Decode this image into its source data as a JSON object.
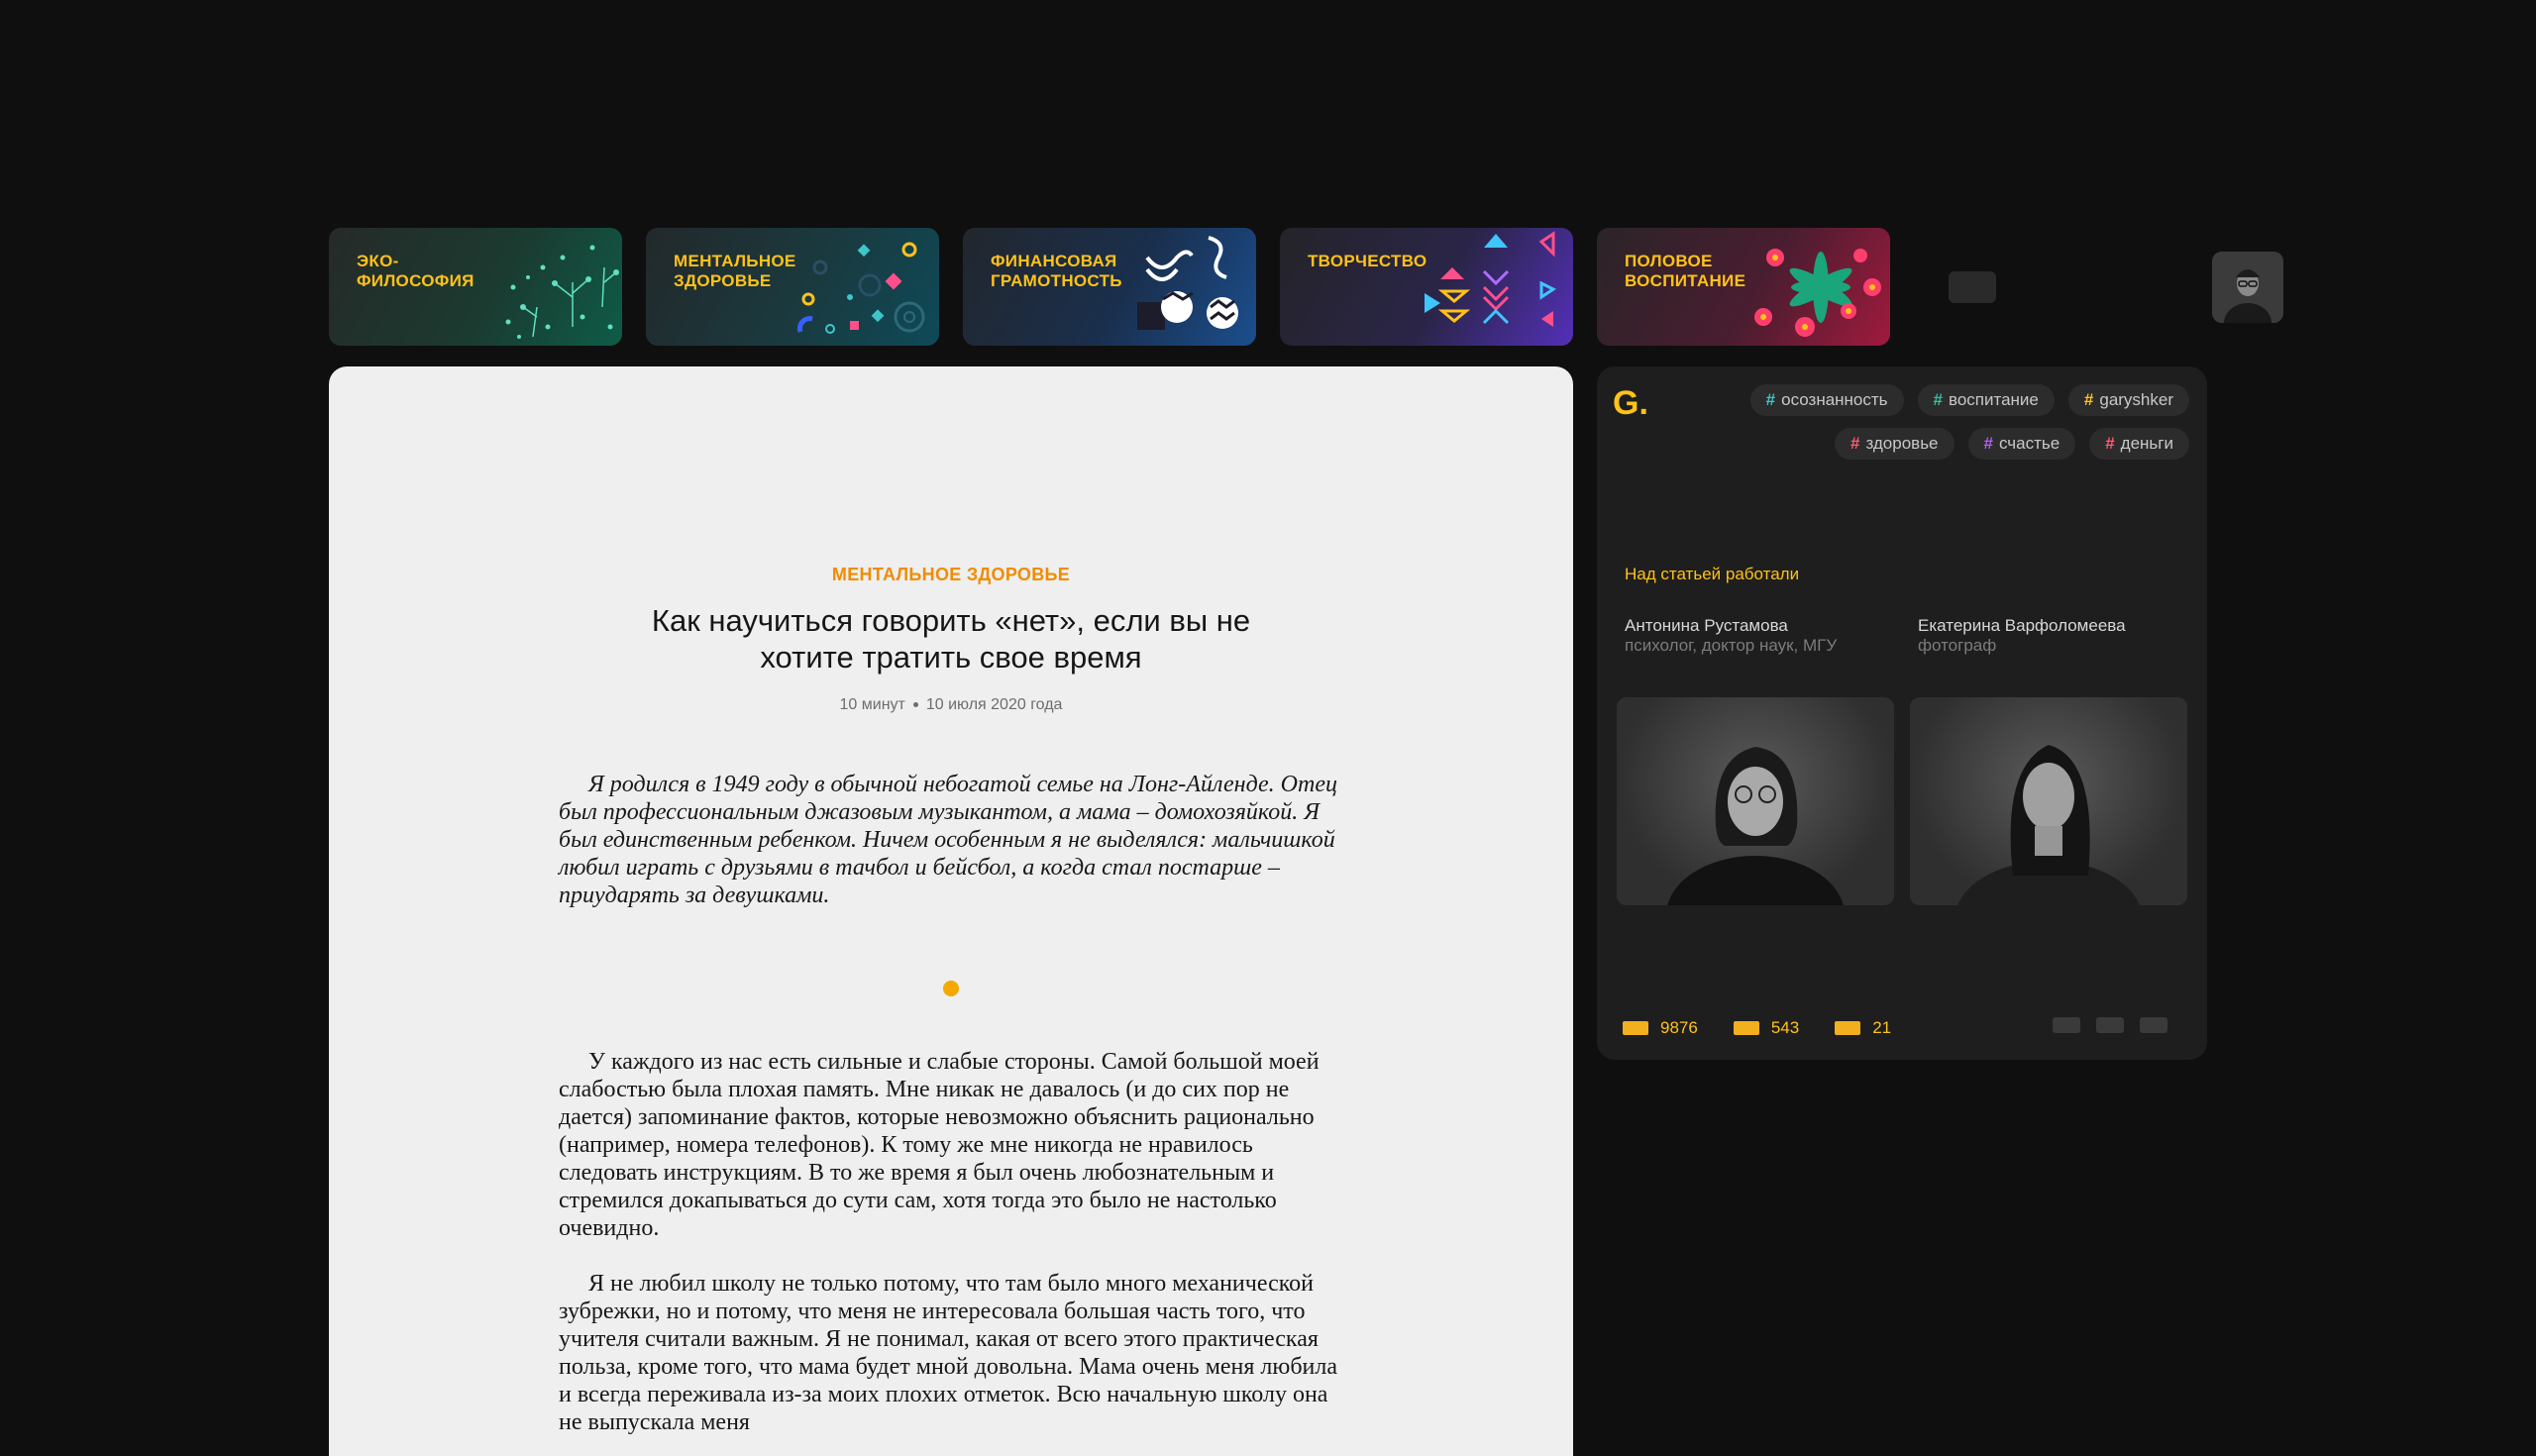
{
  "categories": [
    {
      "label": "Эко-философия",
      "icon": "eco-philosophy-art"
    },
    {
      "label": "Ментальное здоровье",
      "icon": "mental-health-art"
    },
    {
      "label": "Финансовая грамотность",
      "icon": "financial-literacy-art"
    },
    {
      "label": "Творчество",
      "icon": "creativity-art"
    },
    {
      "label": "Половое воспитание",
      "icon": "sex-education-art"
    }
  ],
  "article": {
    "rubric": "Ментальное здоровье",
    "title": "Как научиться говорить «нет», если вы не хотите тратить свое время",
    "read_time": "10 минут",
    "date": "10 июля 2020 года",
    "lead": "Я родился в 1949 году в обычной небогатой семье на Лонг-Айленде. Отец был профессиональным джазовым музыкантом, а мама – домохозяйкой. Я был единственным ребенком. Ничем особенным я не выделялся: мальчишкой любил играть с друзьями в тачбол и бейсбол, а когда стал постарше – приударять за девушками.",
    "paragraphs": [
      "У каждого из нас есть сильные и слабые стороны. Самой большой моей слабостью была плохая память. Мне никак не давалось (и до сих пор не дается) запоминание фактов, которые невозможно объяснить рационально (например, номера телефонов). К тому же мне никогда не нравилось следовать инструкциям. В то же время я был очень любознательным и стремился докапываться до сути сам, хотя тогда это было не настолько очевидно.",
      "Я не любил школу не только потому, что там было много механической зубрежки, но и потому, что меня не интересовала большая часть того, что учителя считали важным. Я не понимал, какая от всего этого практическая польза, кроме того, что мама будет мной довольна. Мама очень меня любила и всегда переживала из-за моих плохих отметок. Всю начальную школу она не выпускала меня"
    ]
  },
  "sidebar": {
    "logo": "G.",
    "tags": [
      {
        "label": "осознанность",
        "color": "#3ec6c9"
      },
      {
        "label": "воспитание",
        "color": "#2ec4a0"
      },
      {
        "label": "garyshker",
        "color": "#ffc21a"
      },
      {
        "label": "здоровье",
        "color": "#ff5a6a"
      },
      {
        "label": "счастье",
        "color": "#b65cf0"
      },
      {
        "label": "деньги",
        "color": "#ff5a6a"
      }
    ],
    "worked_label": "Над статьей работали",
    "authors": [
      {
        "name": "Антонина Рустамова",
        "role": "психолог, доктор наук, МГУ"
      },
      {
        "name": "Екатерина Варфоломеева",
        "role": "фотограф"
      }
    ],
    "stats": [
      {
        "icon": "views-icon",
        "value": "9876"
      },
      {
        "icon": "likes-icon",
        "value": "543"
      },
      {
        "icon": "comments-icon",
        "value": "21"
      }
    ]
  }
}
